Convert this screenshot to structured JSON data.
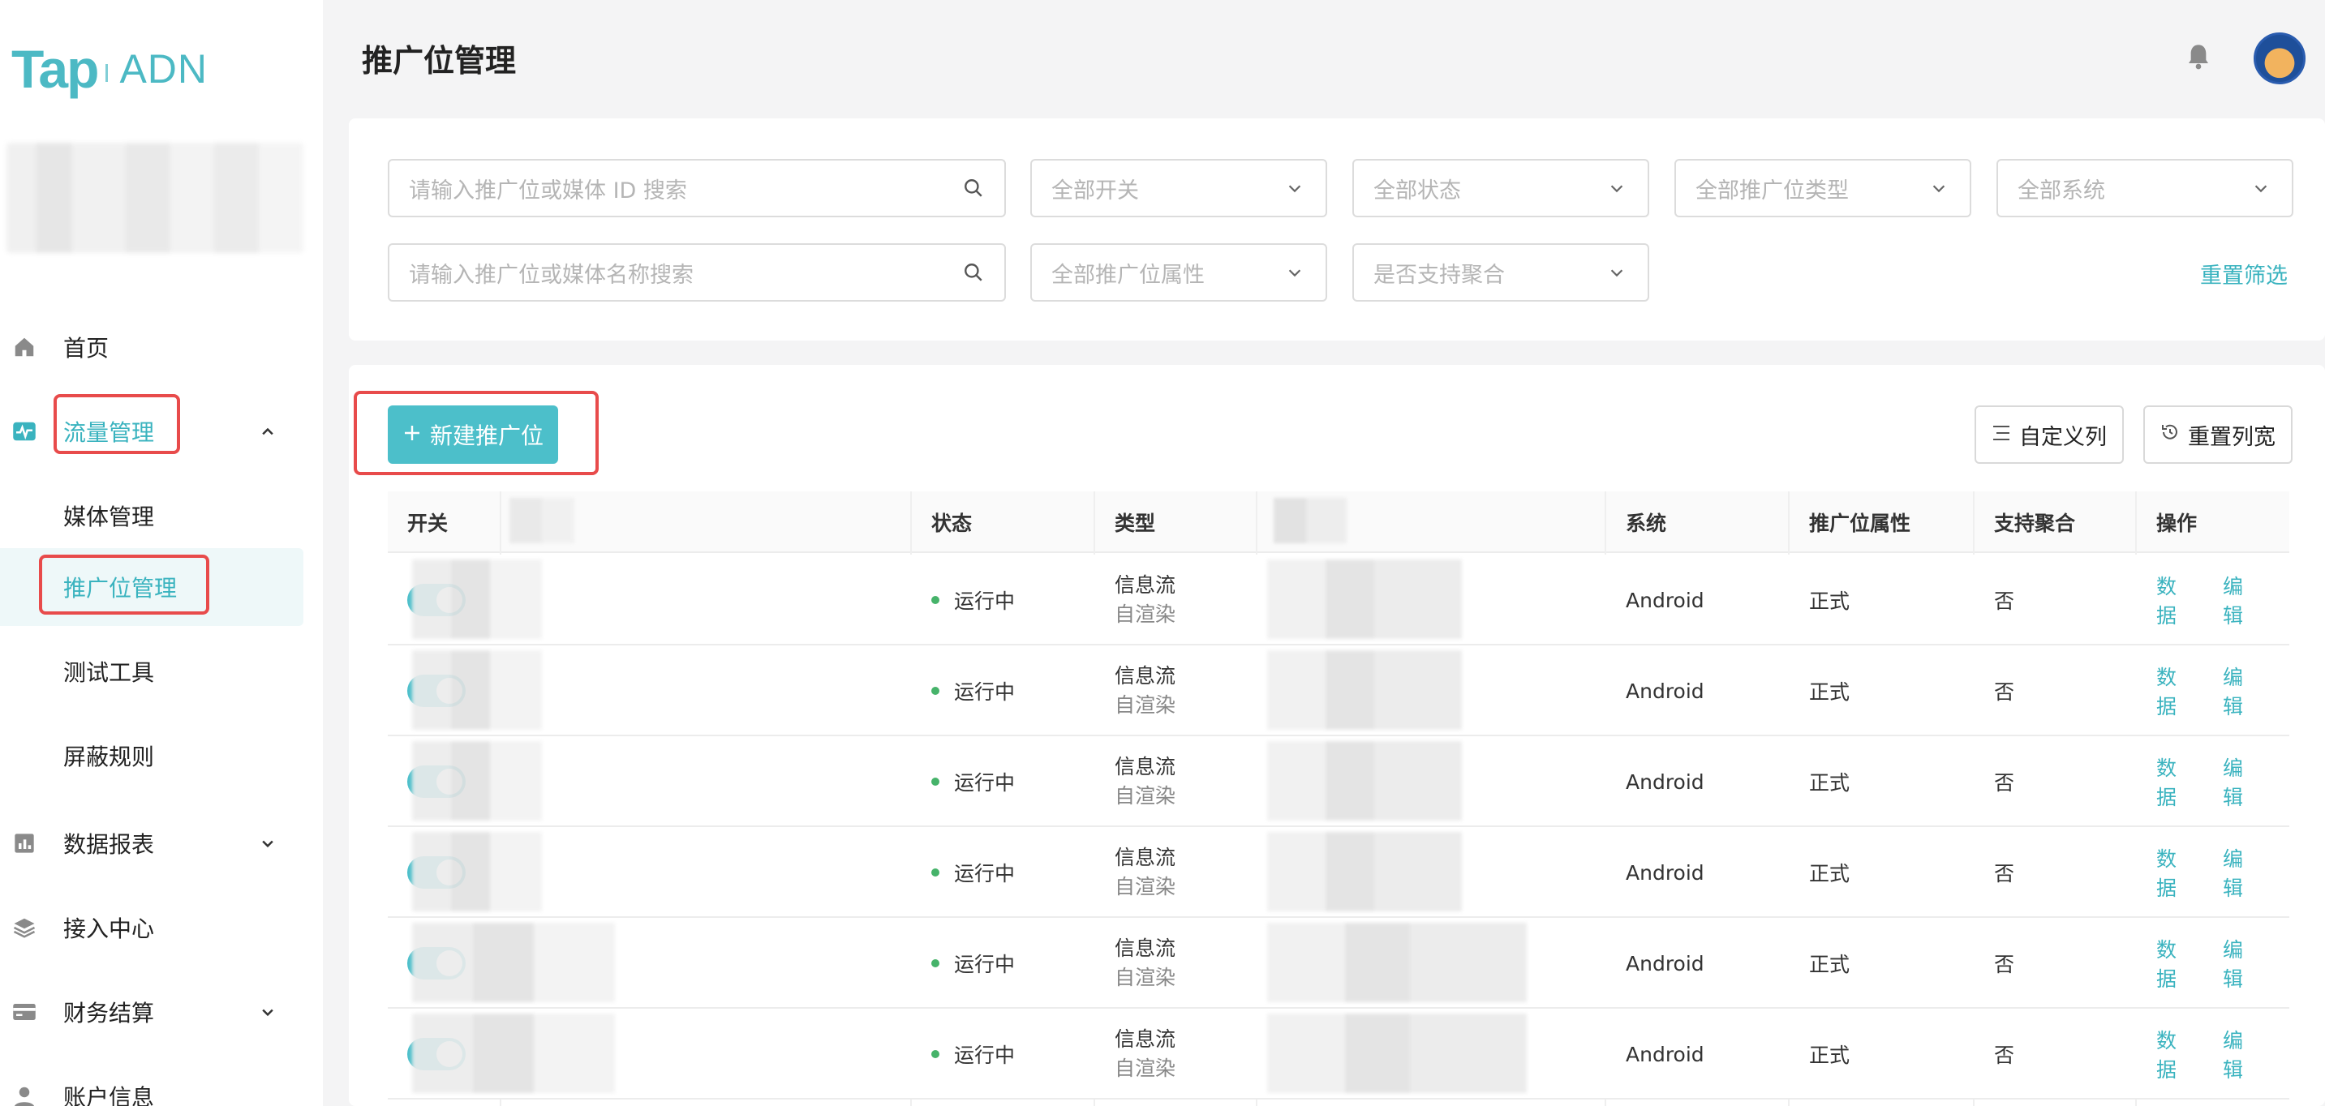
{
  "app": {
    "logo_tap": "Tap",
    "logo_adn": "ADN"
  },
  "sidebar": {
    "items": [
      {
        "label": "首页",
        "icon": "home-icon"
      },
      {
        "label": "流量管理",
        "icon": "traffic-chart-icon",
        "expanded": true
      },
      {
        "label": "媒体管理"
      },
      {
        "label": "推广位管理",
        "active": true
      },
      {
        "label": "测试工具"
      },
      {
        "label": "屏蔽规则"
      },
      {
        "label": "数据报表",
        "icon": "bar-chart-icon"
      },
      {
        "label": "接入中心",
        "icon": "layers-icon"
      },
      {
        "label": "财务结算",
        "icon": "card-icon"
      },
      {
        "label": "账户信息",
        "icon": "user-icon"
      }
    ]
  },
  "header": {
    "title": "推广位管理"
  },
  "filters": {
    "search_id_placeholder": "请输入推广位或媒体 ID 搜索",
    "search_name_placeholder": "请输入推广位或媒体名称搜索",
    "switch": "全部开关",
    "status": "全部状态",
    "type": "全部推广位类型",
    "system": "全部系统",
    "attribute": "全部推广位属性",
    "aggregation": "是否支持聚合",
    "reset": "重置筛选"
  },
  "toolbar": {
    "new_label": "新建推广位",
    "custom_columns": "自定义列",
    "reset_width": "重置列宽"
  },
  "table": {
    "headers": {
      "switch": "开关",
      "status": "状态",
      "type": "类型",
      "system": "系统",
      "attribute": "推广位属性",
      "aggregation": "支持聚合",
      "actions": "操作"
    },
    "rows": [
      {
        "status": "运行中",
        "type": "信息流",
        "render": "自渲染",
        "system": "Android",
        "attribute": "正式",
        "aggregation": "否",
        "data": "数据",
        "edit": "编辑"
      },
      {
        "status": "运行中",
        "type": "信息流",
        "render": "自渲染",
        "system": "Android",
        "attribute": "正式",
        "aggregation": "否",
        "data": "数据",
        "edit": "编辑"
      },
      {
        "status": "运行中",
        "type": "信息流",
        "render": "自渲染",
        "system": "Android",
        "attribute": "正式",
        "aggregation": "否",
        "data": "数据",
        "edit": "编辑"
      },
      {
        "status": "运行中",
        "type": "信息流",
        "render": "自渲染",
        "system": "Android",
        "attribute": "正式",
        "aggregation": "否",
        "data": "数据",
        "edit": "编辑"
      },
      {
        "status": "运行中",
        "type": "信息流",
        "render": "自渲染",
        "system": "Android",
        "attribute": "正式",
        "aggregation": "否",
        "data": "数据",
        "edit": "编辑"
      },
      {
        "status": "运行中",
        "type": "信息流",
        "render": "自渲染",
        "system": "Android",
        "attribute": "正式",
        "aggregation": "否",
        "data": "数据",
        "edit": "编辑"
      }
    ]
  },
  "colors": {
    "accent": "#4cbfca",
    "highlight": "#e84b4b",
    "running": "#46b36a"
  }
}
